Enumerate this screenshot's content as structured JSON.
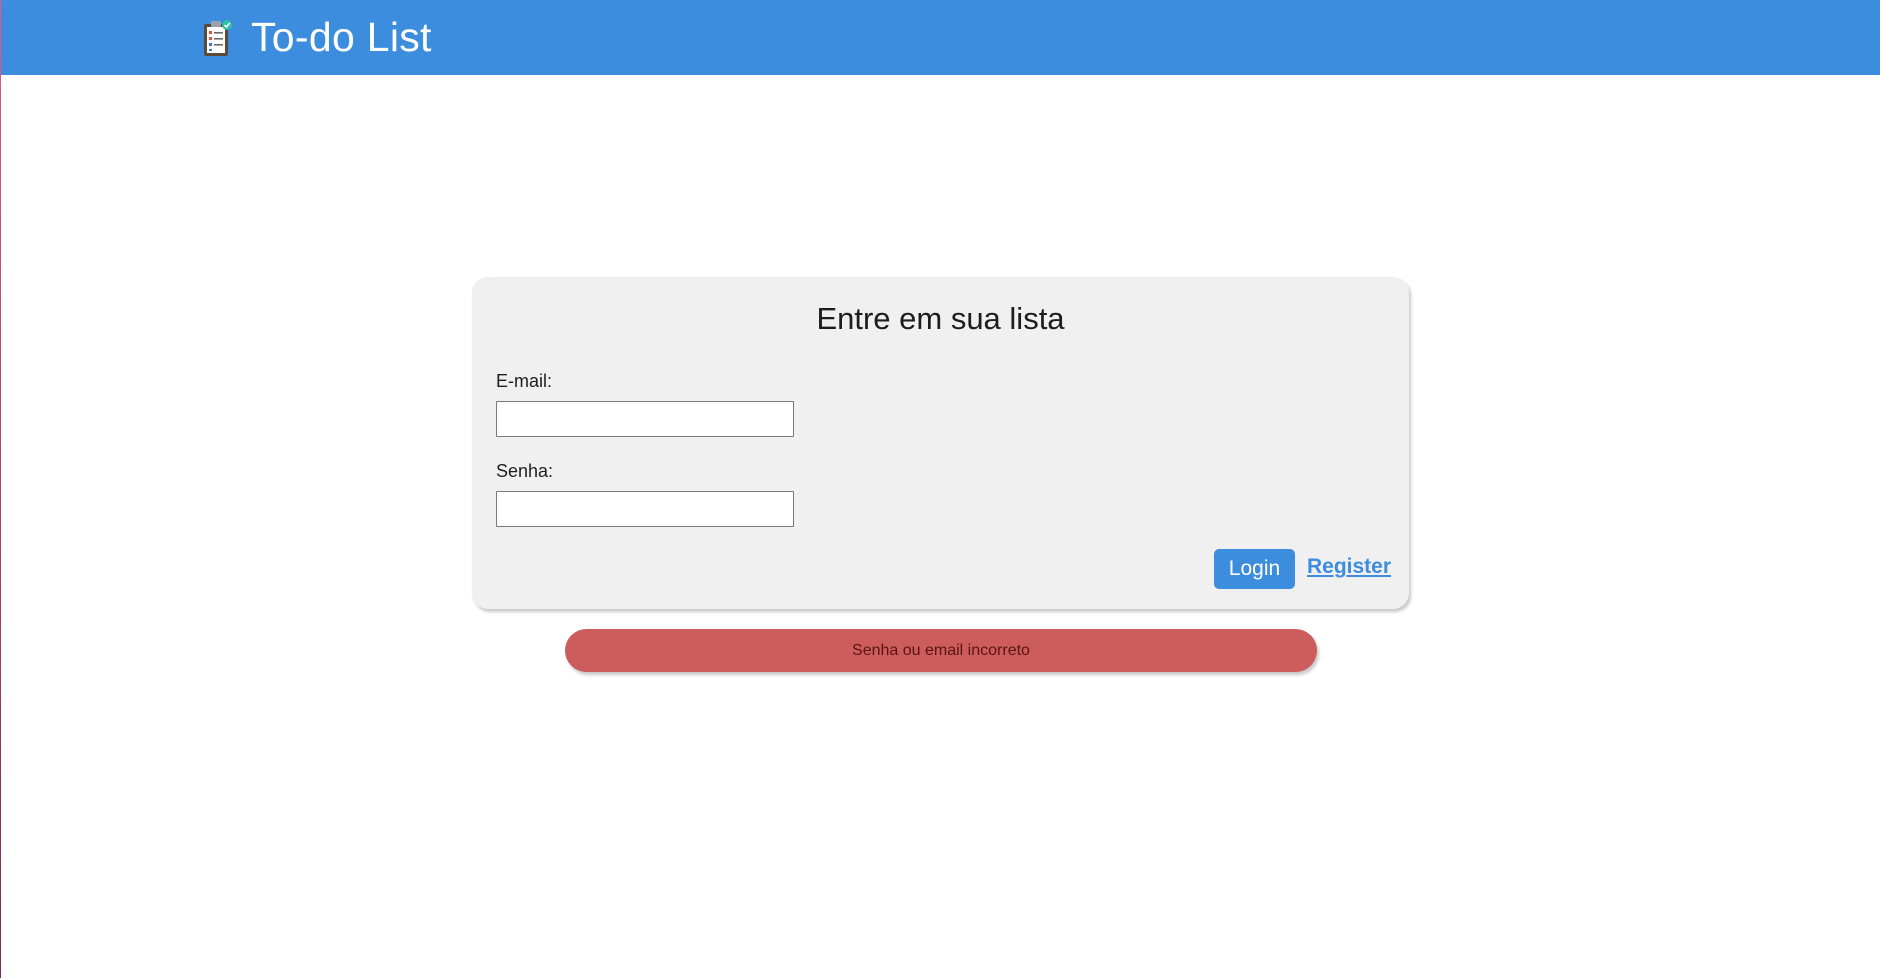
{
  "header": {
    "title": "To-do List",
    "icon": "clipboard-checklist-icon",
    "background_color": "#3d8ddf"
  },
  "login_card": {
    "title": "Entre em sua lista",
    "email": {
      "label": "E-mail:",
      "value": ""
    },
    "password": {
      "label": "Senha:",
      "value": ""
    },
    "login_label": "Login",
    "register_label": "Register"
  },
  "error": {
    "message": "Senha ou email incorreto",
    "color": "#cd5c5c"
  }
}
